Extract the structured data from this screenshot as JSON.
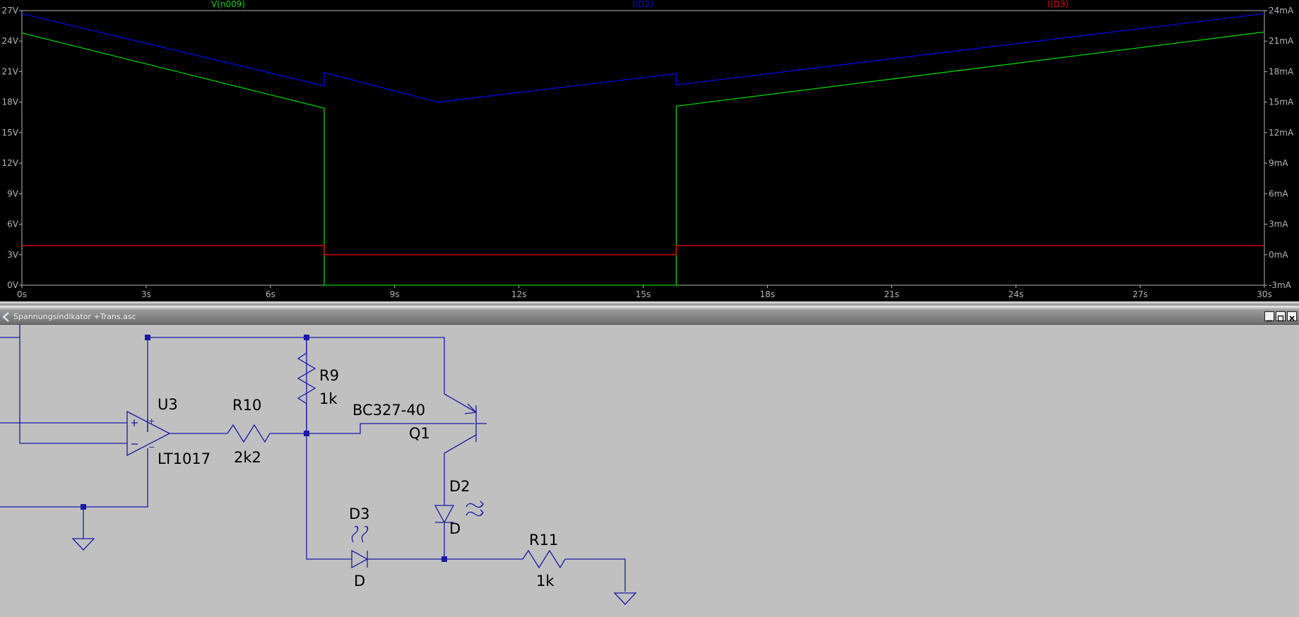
{
  "plot": {
    "traces": [
      {
        "label": "V(n009)",
        "color": "#00d000"
      },
      {
        "label": "I(D2)",
        "color": "#0000e0"
      },
      {
        "label": "I(D3)",
        "color": "#e00000"
      }
    ],
    "x_ticks": [
      "0s",
      "3s",
      "6s",
      "9s",
      "12s",
      "15s",
      "18s",
      "21s",
      "24s",
      "27s",
      "30s"
    ],
    "y_left_ticks": [
      "27V",
      "24V",
      "21V",
      "18V",
      "15V",
      "12V",
      "9V",
      "6V",
      "3V",
      "0V"
    ],
    "y_right_ticks": [
      "24mA",
      "21mA",
      "18mA",
      "15mA",
      "12mA",
      "9mA",
      "6mA",
      "3mA",
      "0mA",
      "-3mA"
    ],
    "grid_color": "#b4b4b4",
    "background": "#000000"
  },
  "chart_data": {
    "type": "line",
    "x_unit": "s",
    "xlim": [
      0,
      30
    ],
    "ylim_left": [
      0,
      27
    ],
    "ylim_right": [
      -3,
      24
    ],
    "series": [
      {
        "name": "V(n009)",
        "axis": "left",
        "unit": "V",
        "x": [
          0,
          7.3,
          7.3,
          15.8,
          15.8,
          30
        ],
        "y": [
          24.8,
          17.4,
          0,
          0,
          17.6,
          24.9
        ]
      },
      {
        "name": "I(D2)",
        "axis": "right",
        "unit": "mA",
        "x": [
          0,
          7.3,
          7.3,
          10.05,
          15.8,
          15.8,
          30
        ],
        "y": [
          23.7,
          16.6,
          17.9,
          15.0,
          17.8,
          16.7,
          23.7
        ]
      },
      {
        "name": "I(D3)",
        "axis": "right",
        "unit": "mA",
        "x": [
          0,
          7.3,
          7.3,
          15.8,
          15.8,
          30
        ],
        "y": [
          0.9,
          0.9,
          0,
          0,
          0.9,
          0.9
        ]
      }
    ]
  },
  "window": {
    "title": "Spannungsindikator +Trans.asc"
  },
  "schematic": {
    "labels": {
      "U3": "U3",
      "LT1017": "LT1017",
      "R10": "R10",
      "R10_val": "2k2",
      "R9": "R9",
      "R9_val": "1k",
      "BC327": "BC327-40",
      "Q1": "Q1",
      "D2": "D2",
      "D2_model": "D",
      "D3": "D3",
      "D3_model": "D",
      "R11": "R11",
      "R11_val": "1k"
    }
  }
}
